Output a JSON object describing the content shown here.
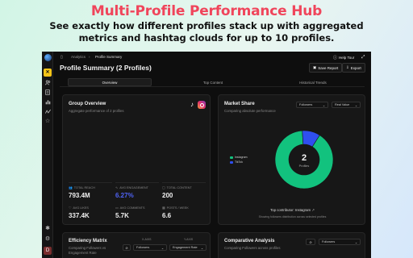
{
  "hero": {
    "title": "Multi-Profile Performance Hub",
    "subtitle": "See exactly how different profiles stack up with aggregated metrics and hashtag clouds for up to 10 profiles."
  },
  "colors": {
    "hero_title": "#f0455b",
    "instagram": "#12c27e",
    "tiktok": "#2f4ff0",
    "engagement": "#4f63f5",
    "app_bg": "#0e0e0e"
  },
  "sidebar": {
    "icons": [
      "logo-icon",
      "extension-icon",
      "people-icon",
      "document-icon",
      "bar-chart-icon",
      "trend-icon",
      "star-icon",
      "bug-icon",
      "settings-icon"
    ],
    "avatar_initial": "D"
  },
  "topbar": {
    "breadcrumb_root": "Analytics",
    "breadcrumb_sep": "›",
    "breadcrumb_current": "Profile Summary",
    "help_label": "Help Tour"
  },
  "header": {
    "page_title": "Profile Summary (2 Profiles)",
    "save_report_label": "Save Report",
    "export_label": "Export"
  },
  "tabs": [
    "Overview",
    "Top Content",
    "Historical Trends"
  ],
  "group_overview": {
    "title": "Group Overview",
    "subtitle": "Aggregate performance of 2 profiles",
    "metrics": [
      {
        "label": "TOTAL REACH",
        "value": "793.4M",
        "icon": "people-icon"
      },
      {
        "label": "AVG ENGAGEMENT",
        "value": "6.27%",
        "icon": "pulse-icon",
        "highlight": true
      },
      {
        "label": "TOTAL CONTENT",
        "value": "200",
        "icon": "image-icon"
      },
      {
        "label": "AVG LIKES",
        "value": "337.4K",
        "icon": "heart-icon"
      },
      {
        "label": "AVG COMMENTS",
        "value": "5.7K",
        "icon": "comment-icon"
      },
      {
        "label": "POSTS / WEEK",
        "value": "6.6",
        "icon": "calendar-icon"
      }
    ]
  },
  "market_share": {
    "title": "Market Share",
    "subtitle": "Comparing absolute performance",
    "metric_select": "Followers",
    "mode_select": "Real Value",
    "center_value": "2",
    "center_label": "Profiles",
    "legend": [
      "Instagram",
      "TikTok"
    ],
    "top_contributor": "Top contributor: Instagram",
    "footnote": "Showing followers distribution across selected profiles"
  },
  "chart_data": {
    "type": "pie",
    "categories": [
      "Instagram",
      "TikTok"
    ],
    "values": [
      90,
      10
    ]
  },
  "efficiency": {
    "title": "Efficiency Matrix",
    "subtitle": "Comparing Followers vs Engagement Rate",
    "x_axis_label": "X-AXIS",
    "y_axis_label": "Y-AXIS",
    "x_select": "Followers",
    "y_select": "Engagement Rate"
  },
  "comparative": {
    "title": "Comparative Analysis",
    "subtitle": "Comparing Followers across profiles",
    "select": "Followers"
  }
}
